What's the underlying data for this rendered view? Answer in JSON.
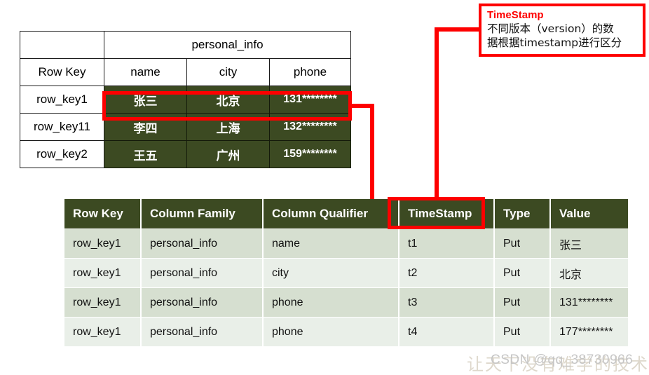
{
  "colors": {
    "dark_green": "#3c4a22",
    "highlight_red": "#fe0000",
    "row_dark": "#d6dfd0",
    "row_light": "#e9efe8",
    "table_border": "#1a1a1a"
  },
  "top_table": {
    "column_family_label": "personal_info",
    "empty_corner": "",
    "headers": {
      "row_key": "Row Key",
      "name": "name",
      "city": "city",
      "phone": "phone"
    },
    "rows": [
      {
        "row_key": "row_key1",
        "name": "张三",
        "city": "北京",
        "phone": "131********",
        "highlighted": true
      },
      {
        "row_key": "row_key11",
        "name": "李四",
        "city": "上海",
        "phone": "132********",
        "highlighted": false
      },
      {
        "row_key": "row_key2",
        "name": "王五",
        "city": "广州",
        "phone": "159********",
        "highlighted": false
      }
    ]
  },
  "bottom_table": {
    "headers": [
      "Row Key",
      "Column Family",
      "Column Qualifier",
      "TimeStamp",
      "Type",
      "Value"
    ],
    "highlighted_header": "TimeStamp",
    "rows": [
      {
        "row_key": "row_key1",
        "column_family": "personal_info",
        "column_qualifier": "name",
        "timestamp": "t1",
        "type": "Put",
        "value": "张三"
      },
      {
        "row_key": "row_key1",
        "column_family": "personal_info",
        "column_qualifier": "city",
        "timestamp": "t2",
        "type": "Put",
        "value": "北京"
      },
      {
        "row_key": "row_key1",
        "column_family": "personal_info",
        "column_qualifier": "phone",
        "timestamp": "t3",
        "type": "Put",
        "value": "131********"
      },
      {
        "row_key": "row_key1",
        "column_family": "personal_info",
        "column_qualifier": "phone",
        "timestamp": "t4",
        "type": "Put",
        "value": "177********"
      }
    ]
  },
  "annotation": {
    "title": "TimeStamp",
    "line1": "不同版本（version）的数",
    "line2": "据根据timestamp进行区分"
  },
  "watermark": {
    "csdn": "CSDN @qq_38730966",
    "chinese": "让天下没有难学的技术"
  }
}
